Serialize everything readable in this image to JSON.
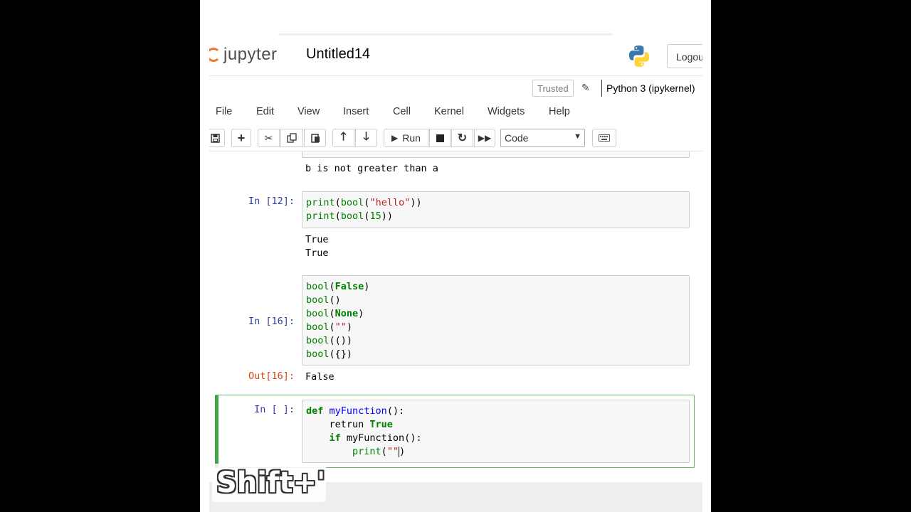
{
  "header": {
    "logo_text": "jupyter",
    "notebook_name": "Untitled14",
    "logout_label": "Logou"
  },
  "status": {
    "trusted_label": "Trusted",
    "kernel_name": "Python 3 (ipykernel)"
  },
  "menubar": {
    "items": [
      "File",
      "Edit",
      "Insert",
      "Cell",
      "Kernel",
      "Widgets",
      "Help"
    ],
    "view": "View"
  },
  "toolbar": {
    "run_label": "Run",
    "cell_type": "Code",
    "icons": [
      "save-icon",
      "plus-icon",
      "cut-icon",
      "copy-icon",
      "paste-icon",
      "arrow-up-icon",
      "arrow-down-icon",
      "play-icon",
      "stop-icon",
      "restart-icon",
      "fast-forward-icon",
      "keyboard-icon"
    ]
  },
  "cells": {
    "prev_output": "b is not greater than a",
    "cell12": {
      "prompt": "In [12]:",
      "lines": [
        "print(bool(\"hello\"))",
        "print(bool(15))"
      ],
      "output": [
        "True",
        "True"
      ]
    },
    "cell16": {
      "prompt": "In [16]:",
      "lines": [
        "bool(False)",
        "bool()",
        "bool(None)",
        "bool(\"\")",
        "bool(())",
        "bool({})"
      ],
      "out_prompt": "Out[16]:",
      "output": "False"
    },
    "current": {
      "prompt": "In [ ]:",
      "lines": [
        "def myFunction():",
        "    retrun True",
        "    if myFunction():",
        "        print(\"\")"
      ]
    }
  },
  "overlay": {
    "keystroke": "Shift+'"
  },
  "colors": {
    "jupyter_orange": "#f37726",
    "prompt_in": "#303f9f",
    "prompt_out": "#d84315",
    "selected_border": "#42a548"
  }
}
